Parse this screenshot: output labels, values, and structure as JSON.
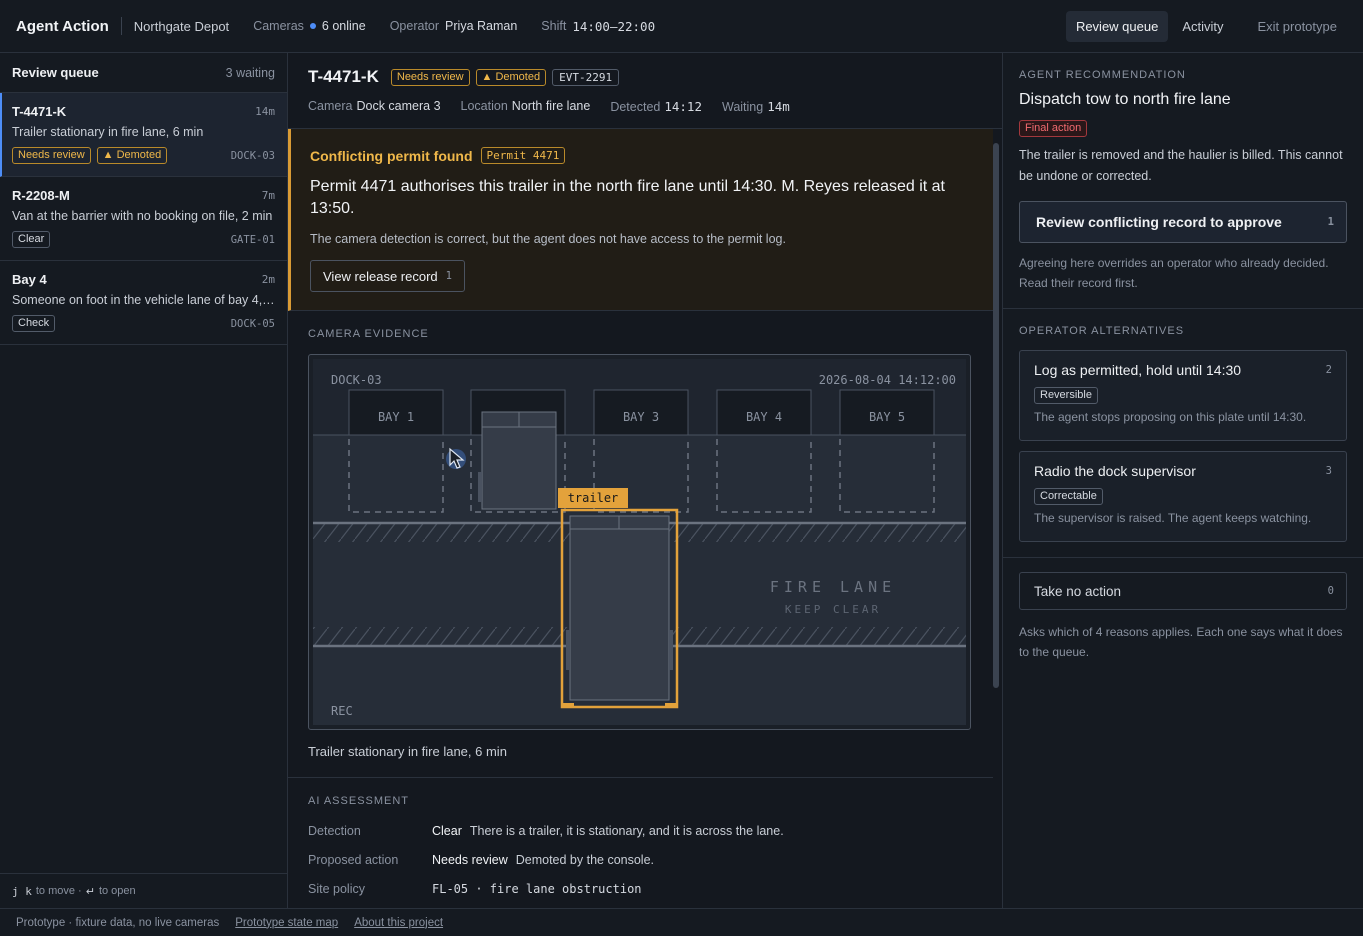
{
  "app": {
    "brand": "Agent Action",
    "site": "Northgate Depot",
    "cameras_label": "Cameras",
    "cameras_value": "6 online",
    "operator_label": "Operator",
    "operator_value": "Priya Raman",
    "shift_label": "Shift",
    "shift_value": "14:00–22:00",
    "nav": [
      "Review queue",
      "Activity",
      "Exit prototype"
    ]
  },
  "queue": {
    "title": "Review queue",
    "count": "3 waiting",
    "items": [
      {
        "plate": "T-4471-K",
        "age": "14m",
        "desc": "Trailer stationary in fire lane, 6 min",
        "tags": [
          "Needs review",
          "▲ Demoted"
        ],
        "camera": "DOCK-03"
      },
      {
        "plate": "R-2208-M",
        "age": "7m",
        "desc": "Van at the barrier with no booking on file, 2 min",
        "tags": [
          "Clear"
        ],
        "camera": "GATE-01"
      },
      {
        "plate": "Bay 4",
        "age": "2m",
        "desc": "Someone on foot in the vehicle lane of bay 4, …",
        "tags": [
          "Check"
        ],
        "camera": "DOCK-05"
      }
    ],
    "footer_keys": "j k",
    "footer_move": "to move ·",
    "footer_enter": "↵",
    "footer_open": "to open"
  },
  "case": {
    "plate": "T-4471-K",
    "tag_review": "Needs review",
    "tag_demoted": "▲ Demoted",
    "event": "EVT-2291",
    "meta": [
      {
        "label": "Camera",
        "value": "Dock camera 3"
      },
      {
        "label": "Location",
        "value": "North fire lane"
      },
      {
        "label": "Detected",
        "value": "14:12"
      },
      {
        "label": "Waiting",
        "value": "14m"
      }
    ]
  },
  "conflict": {
    "title": "Conflicting permit found",
    "permit": "Permit 4471",
    "body": "Permit 4471 authorises this trailer in the north fire lane until 14:30. M. Reyes released it at 13:50.",
    "note": "The camera detection is correct, but the agent does not have access to the permit log.",
    "button": "View release record",
    "button_key": "1"
  },
  "evidence": {
    "label": "Camera evidence",
    "camera_id": "DOCK-03",
    "timestamp": "2026-08-04 14:12:00",
    "bays": [
      "BAY 1",
      "BAY 3",
      "BAY 4",
      "BAY 5"
    ],
    "detection_label": "trailer",
    "lane_text": "FIRE LANE",
    "lane_sub": "KEEP CLEAR",
    "rec": "REC",
    "caption": "Trailer stationary in fire lane, 6 min"
  },
  "assessment": {
    "label": "AI assessment",
    "rows": [
      {
        "key": "Detection",
        "v1": "Clear",
        "v2": "There is a trailer, it is stationary, and it is across the lane."
      },
      {
        "key": "Proposed action",
        "v1": "Needs review",
        "v2": "Demoted by the console."
      },
      {
        "key": "Site policy",
        "v1": "FL-05 · fire lane obstruction",
        "v2": ""
      }
    ]
  },
  "recommendation": {
    "label": "Agent recommendation",
    "title": "Dispatch tow to north fire lane",
    "final_tag": "Final action",
    "desc": "The trailer is removed and the haulier is billed. This cannot be undone or corrected.",
    "button": "Review conflicting record to approve",
    "button_key": "1",
    "hint": "Agreeing here overrides an operator who already decided. Read their record first."
  },
  "alternatives": {
    "label": "Operator alternatives",
    "items": [
      {
        "title": "Log as permitted, hold until 14:30",
        "key": "2",
        "tag": "Reversible",
        "desc": "The agent stops proposing on this plate until 14:30."
      },
      {
        "title": "Radio the dock supervisor",
        "key": "3",
        "tag": "Correctable",
        "desc": "The supervisor is raised. The agent keeps watching."
      }
    ]
  },
  "no_action": {
    "title": "Take no action",
    "key": "0",
    "desc": "Asks which of 4 reasons applies. Each one says what it does to the queue."
  },
  "footer": {
    "note": "Prototype · fixture data, no live cameras",
    "links": [
      "Prototype state map",
      "About this project"
    ]
  }
}
